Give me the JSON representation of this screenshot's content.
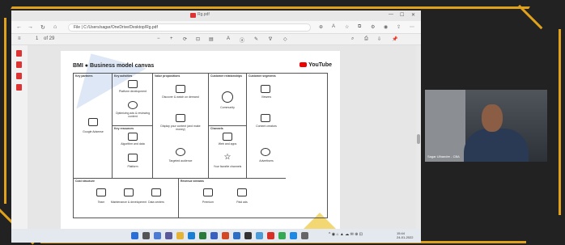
{
  "browser": {
    "tab_title": "Rg.pdf",
    "url": "File | C:/Users/sagar/OneDrive/Desktop/Rg.pdf",
    "page_num": "1",
    "page_total": "of 29"
  },
  "pdf": {
    "title": "BMI ● Business model canvas",
    "brand": "YouTube",
    "cells": {
      "key_partners": {
        "header": "Key partners",
        "items": [
          "Google Adsense"
        ]
      },
      "key_activities": {
        "header": "Key activities",
        "items": [
          "Platform development",
          "Optimizing ads & reviewing content"
        ]
      },
      "key_resources": {
        "header": "Key resources",
        "items": [
          "Algorithm and data",
          "Platform"
        ]
      },
      "value_propositions": {
        "header": "Value propositions",
        "items": [
          "Discover & watch on demand",
          "Display your content (and make money)",
          "Targeted audience"
        ]
      },
      "customer_relationships": {
        "header": "Customer relationships",
        "items": [
          "Community"
        ]
      },
      "channels": {
        "header": "Channels",
        "items": [
          "Web and apps",
          "Your favorite channels"
        ]
      },
      "customer_segments": {
        "header": "Customer segments",
        "items": [
          "Viewers",
          "Content creators",
          "Advertisers"
        ]
      },
      "cost_structure": {
        "header": "Cost structure",
        "items": [
          "Team",
          "Maintenance & development",
          "Data centers"
        ]
      },
      "revenue_streams": {
        "header": "Revenue streams",
        "items": [
          "Premium",
          "Paid ads"
        ]
      }
    }
  },
  "camera": {
    "label": "Sagar Ulhandre - CBA"
  },
  "taskbar": {
    "time": "15:44",
    "date": "24-01-2022"
  },
  "colors": {
    "frame_accent": "#e0a21c",
    "youtube_red": "#e00000"
  }
}
